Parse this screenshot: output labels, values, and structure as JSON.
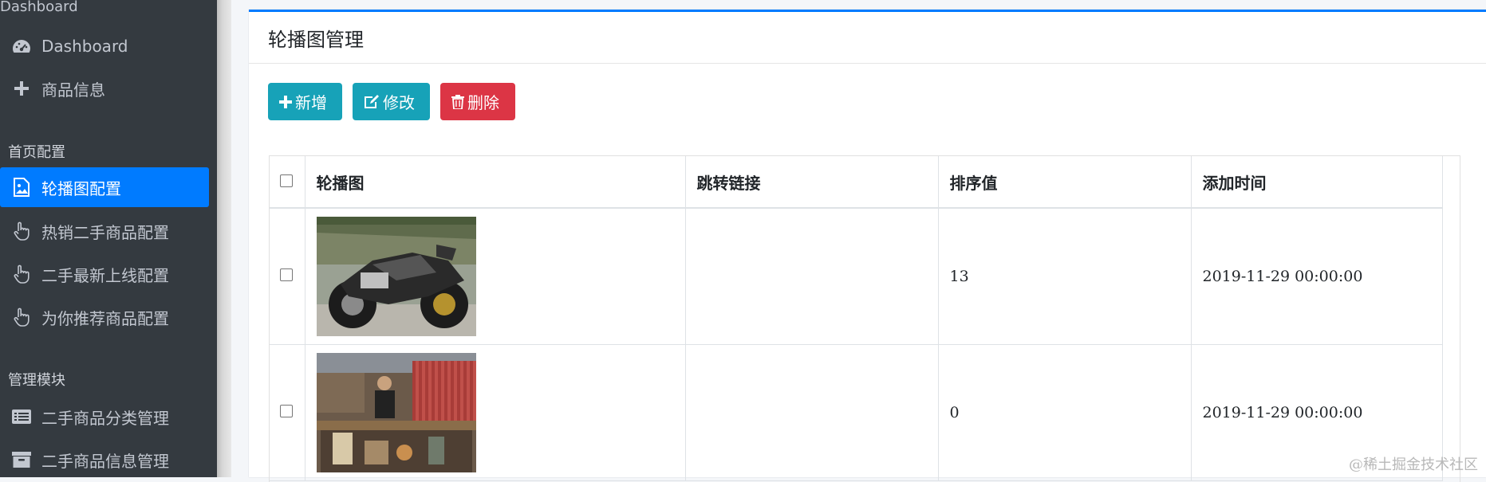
{
  "sidebar": {
    "top_label": "Dashboard",
    "items": [
      {
        "label": "Dashboard",
        "icon": "tachometer-icon"
      },
      {
        "label": "商品信息",
        "icon": "plus-icon"
      }
    ],
    "section1": "首页配置",
    "config_items": [
      {
        "label": "轮播图配置",
        "icon": "image-icon",
        "active": true
      },
      {
        "label": "热销二手商品配置",
        "icon": "hand-pointer-icon"
      },
      {
        "label": "二手最新上线配置",
        "icon": "hand-pointer-icon"
      },
      {
        "label": "为你推荐商品配置",
        "icon": "hand-pointer-icon"
      }
    ],
    "section2": "管理模块",
    "manage_items": [
      {
        "label": "二手商品分类管理",
        "icon": "list-icon"
      },
      {
        "label": "二手商品信息管理",
        "icon": "archive-icon"
      }
    ]
  },
  "card": {
    "title": "轮播图管理"
  },
  "toolbar": {
    "add_label": "新增",
    "edit_label": "修改",
    "delete_label": "删除"
  },
  "table": {
    "columns": [
      "轮播图",
      "跳转链接",
      "排序值",
      "添加时间"
    ],
    "rows": [
      {
        "image": "motorcycle",
        "link": "",
        "sort": "13",
        "time": "2019-11-29 00:00:00"
      },
      {
        "image": "market",
        "link": "",
        "sort": "0",
        "time": "2019-11-29 00:00:00"
      }
    ]
  },
  "watermark": "@稀土掘金技术社区",
  "colors": {
    "sidebar_bg": "#343a40",
    "active": "#007bff",
    "info": "#17a2b8",
    "danger": "#dc3545"
  }
}
